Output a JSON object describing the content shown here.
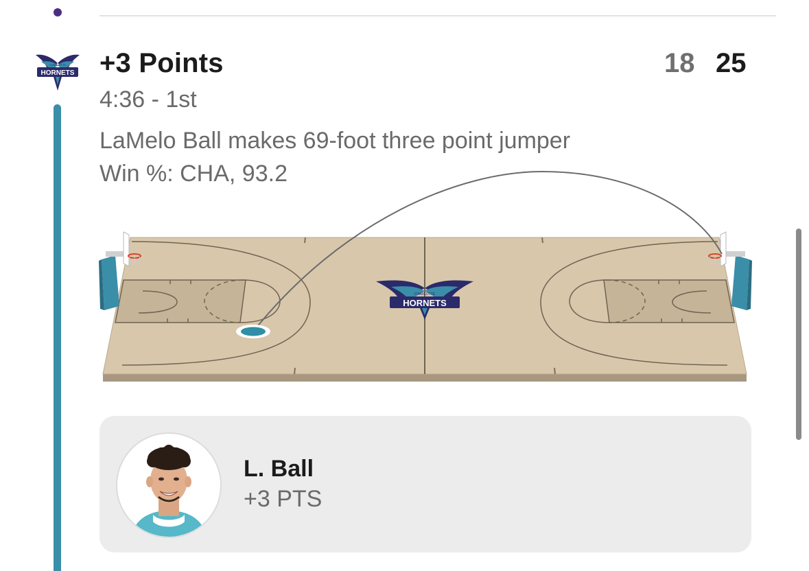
{
  "play": {
    "title": "+3 Points",
    "time": "4:36 - 1st",
    "description": "LaMelo Ball makes 69-foot three point jumper",
    "win_probability": "Win %: CHA, 93.2"
  },
  "score": {
    "away": "18",
    "home": "25"
  },
  "team": {
    "logo_icon": "hornets-logo-icon",
    "logo_text": "HORNETS",
    "logo_subtext": "CHARLOTTE"
  },
  "court": {
    "center_logo_icon": "hornets-logo-icon",
    "center_logo_text": "HORNETS",
    "center_logo_subtext": "CHARLOTTE"
  },
  "player": {
    "name": "L. Ball",
    "stat": "+3 PTS"
  },
  "colors": {
    "timeline": "#3a8ea8",
    "timeline_dot": "#4b2e83",
    "court_floor": "#d8c7ab",
    "paint": "#c9b79b",
    "shot_marker": "#2f8fa6",
    "hornets_purple": "#2b2a6b",
    "hornets_teal": "#3a8ea8"
  }
}
